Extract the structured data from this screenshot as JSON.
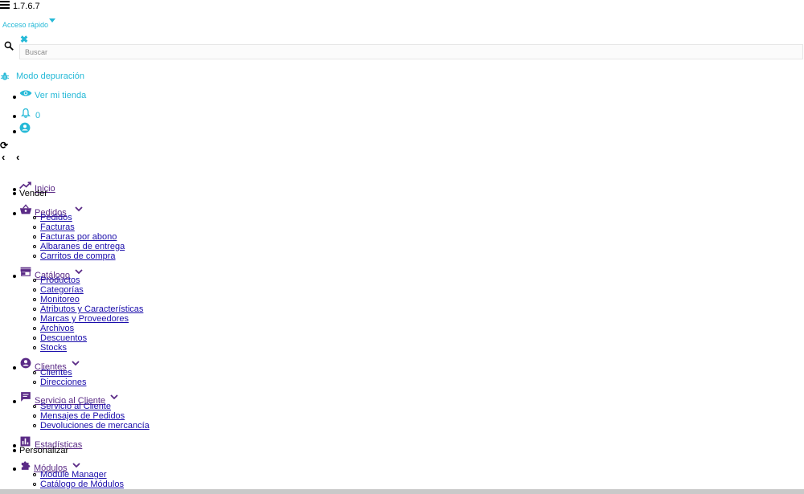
{
  "header": {
    "version": "1.7.6.7",
    "quick_access": "Acceso rápido",
    "search_placeholder": "Buscar",
    "debug_mode": "Modo depuración",
    "view_store": "Ver mi tienda",
    "notifications_count": "0"
  },
  "nav": {
    "home": "Inicio",
    "section_sell": "Vender",
    "orders": {
      "label": "Pedidos",
      "items": [
        "Pedidos",
        "Facturas",
        "Facturas por abono",
        "Albaranes de entrega",
        "Carritos de compra"
      ]
    },
    "catalog": {
      "label": "Catálogo",
      "items": [
        "Productos",
        "Categorías",
        "Monitoreo",
        "Atributos y Características",
        "Marcas y Proveedores",
        "Archivos",
        "Descuentos",
        "Stocks"
      ]
    },
    "customers": {
      "label": "Clientes",
      "items": [
        "Clientes",
        "Direcciones"
      ]
    },
    "customer_service": {
      "label": "Servicio al Cliente",
      "items": [
        "Servicio al Cliente",
        "Mensajes de Pedidos",
        "Devoluciones de mercancía"
      ]
    },
    "stats": "Estadísticas",
    "section_customize": "Personalizar",
    "modules": {
      "label": "Módulos",
      "items": [
        "Module Manager",
        "Catálogo de Módulos"
      ]
    }
  },
  "colors": {
    "accent": "#25b9d7",
    "nav_icon": "#5a2a86",
    "link": "#1a0dab"
  }
}
